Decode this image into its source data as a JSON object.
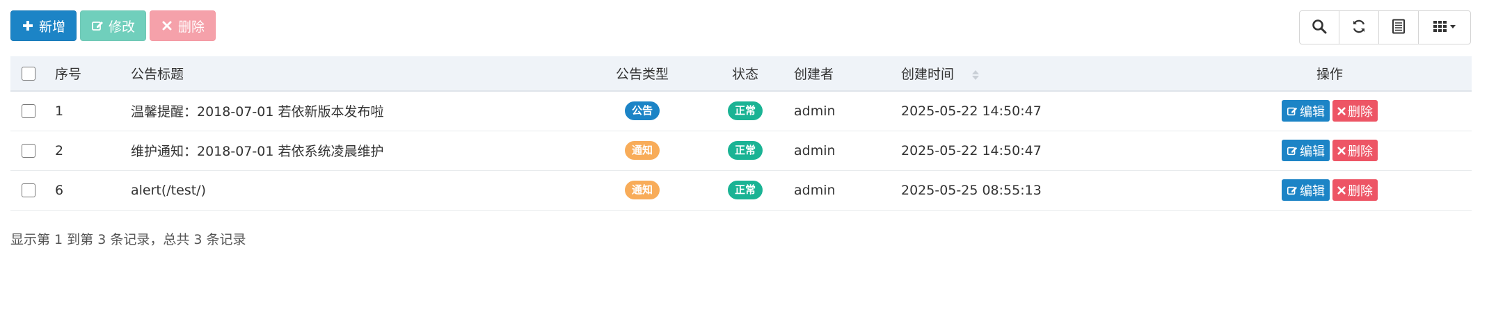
{
  "toolbar": {
    "add_label": "新增",
    "edit_label": "修改",
    "delete_label": "删除"
  },
  "tools": {
    "items": [
      "search-icon",
      "refresh-icon",
      "export-icon",
      "columns-icon"
    ]
  },
  "table": {
    "headers": {
      "seq": "序号",
      "title": "公告标题",
      "type": "公告类型",
      "status": "状态",
      "creator": "创建者",
      "time": "创建时间",
      "ops": "操作"
    },
    "rows": [
      {
        "seq": "1",
        "title": "温馨提醒：2018-07-01 若依新版本发布啦",
        "type": "公告",
        "status": "正常",
        "creator": "admin",
        "time": "2025-05-22 14:50:47",
        "edit": "编辑",
        "del": "删除"
      },
      {
        "seq": "2",
        "title": "维护通知：2018-07-01 若依系统凌晨维护",
        "type": "通知",
        "status": "正常",
        "creator": "admin",
        "time": "2025-05-22 14:50:47",
        "edit": "编辑",
        "del": "删除"
      },
      {
        "seq": "6",
        "title": "alert(/test/)",
        "type": "通知",
        "status": "正常",
        "creator": "admin",
        "time": "2025-05-25 08:55:13",
        "edit": "编辑",
        "del": "删除"
      }
    ]
  },
  "colors": {
    "primary": "#1c84c6",
    "success": "#1ab394",
    "danger": "#ed5565",
    "warning": "#f8ac59"
  },
  "footer": {
    "summary": "显示第 1 到第 3 条记录，总共 3 条记录"
  }
}
